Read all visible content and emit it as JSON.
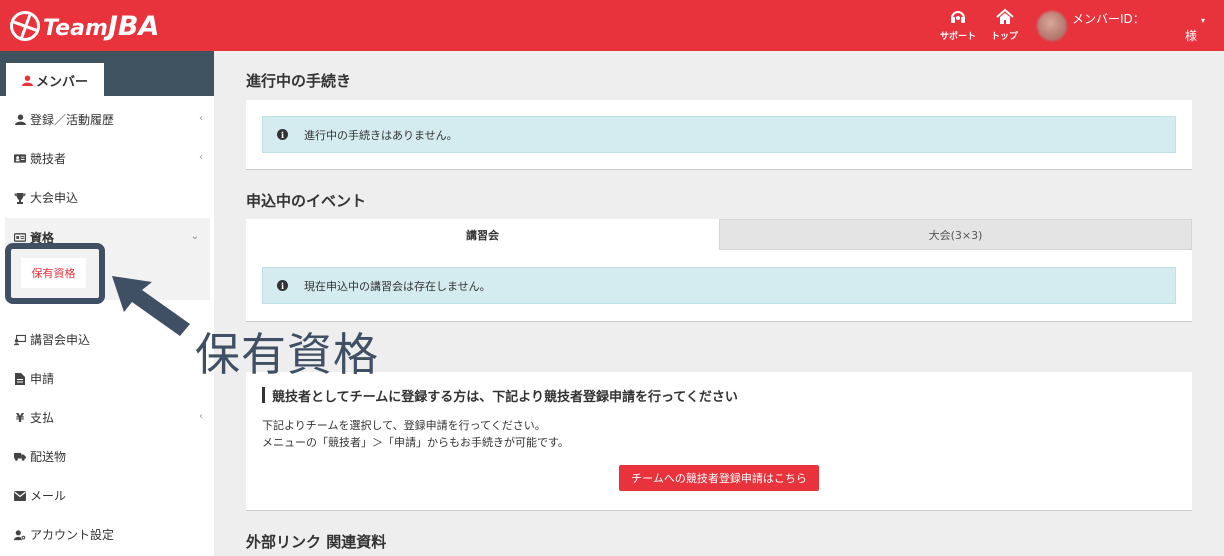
{
  "header": {
    "logo_prefix": "Team",
    "logo_main": "JBA",
    "support_label": "サポート",
    "top_label": "トップ",
    "member_id_label": "メンバーID：",
    "honorific": "様"
  },
  "sidebar": {
    "tab_label": "メンバー",
    "items": [
      {
        "label": "登録／活動履歴",
        "icon": "user-icon",
        "chevron": "‹"
      },
      {
        "label": "競技者",
        "icon": "id-card-icon",
        "chevron": "‹"
      },
      {
        "label": "大会申込",
        "icon": "trophy-icon"
      },
      {
        "label": "資格",
        "icon": "certificate-icon",
        "chevron": "⌄"
      },
      {
        "label": "講習会申込",
        "icon": "lecture-icon"
      },
      {
        "label": "申請",
        "icon": "document-icon"
      },
      {
        "label": "支払",
        "icon": "yen-icon",
        "chevron": "‹"
      },
      {
        "label": "配送物",
        "icon": "truck-icon"
      },
      {
        "label": "メール",
        "icon": "mail-icon"
      },
      {
        "label": "アカウント設定",
        "icon": "user-gear-icon"
      }
    ],
    "sub_item_label": "保有資格"
  },
  "annotation": {
    "label": "保有資格"
  },
  "main": {
    "procedures_title": "進行中の手続き",
    "procedures_message": "進行中の手続きはありません。",
    "events_title": "申込中のイベント",
    "tabs": [
      {
        "label": "講習会"
      },
      {
        "label": "大会(3×3)"
      }
    ],
    "events_message": "現在申込中の講習会は存在しません。",
    "register_title": "競技者としてチームに登録する方は、下記より競技者登録申請を行ってください",
    "register_text1": "下記よりチームを選択して、登録申請を行ってください。",
    "register_text2": "メニューの「競技者」＞「申請」からもお手続きが可能です。",
    "register_button": "チームへの競技者登録申請はこちら",
    "links_title": "外部リンク 関連資料"
  },
  "colors": {
    "brand_red": "#e8323c",
    "sidebar_dark": "#3f5260",
    "info_bg": "#d4ebef",
    "annotation": "#3f4f64"
  }
}
